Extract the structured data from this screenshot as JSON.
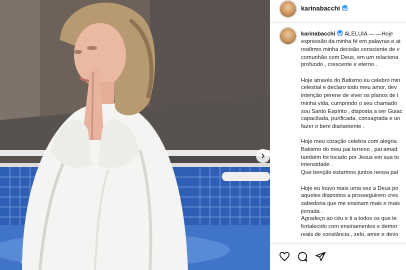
{
  "post": {
    "username": "karinabacchi",
    "caption": {
      "intro": "ALELUIA — —Hoje",
      "lines1": [
        "expressão da minha fé em palavras e at",
        "reafirmo minha decisão consciente de v",
        "comunhão com Deus, em um relaciona",
        "profundo , crescente e eterno ."
      ],
      "lines2": [
        "Hoje através do Batismo eu celebro min",
        "celestial e declaro todo meu amor, dev",
        "intenção perene de viver os planos de l",
        "minha vida, cumprindo o seu chamado",
        "sou Santo Espírito , disposta a ser Guiac",
        "capacitada, purificada, consagrada e un",
        "fazer o bem diariamente ."
      ],
      "lines3": [
        "Hoje meu coração celebra com alegria",
        "Batismo do meu pai terreno , pai amad",
        "também foi tocado por Jesus em sua to",
        "intensidade .",
        "Que benção estarmos juntos nessa pal"
      ],
      "lines4": [
        "Hoje eu louvo mais uma vez a Deus po",
        "aqueles dispostos a prosseguirem cres",
        "sabedoria que me ensinam mais e mais",
        "jornada .",
        "Agradeço ao céu e ti a todos os que te",
        "fortalecido com ensinamentos e demor",
        "reais de constância , zelo, amor e devo"
      ]
    }
  },
  "icons": {
    "like": "heart-icon",
    "comment": "comment-icon",
    "share": "send-icon",
    "next": "chevron-right-icon",
    "verified": "verified-badge-icon"
  },
  "colors": {
    "verified": "#3897f0",
    "pool_water": "#3f74c9",
    "tiles": "#2f5fb4"
  }
}
